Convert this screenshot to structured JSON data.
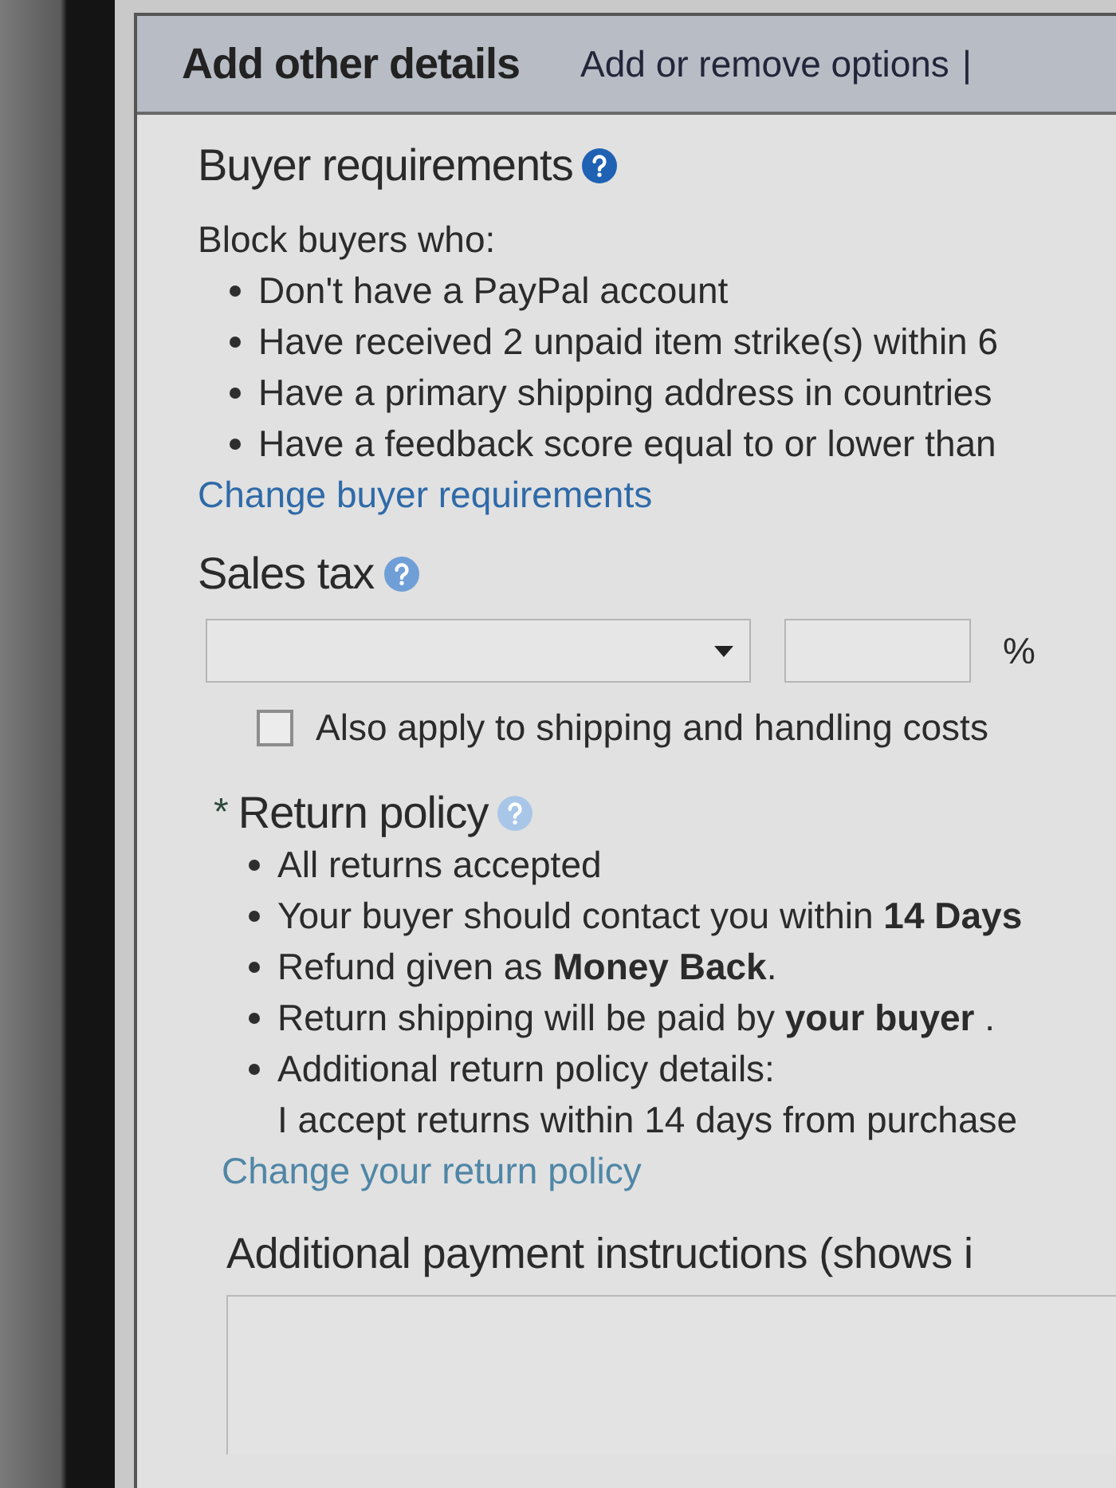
{
  "header": {
    "title": "Add other details",
    "link": "Add or remove options",
    "separator": "|"
  },
  "buyer_requirements": {
    "title": "Buyer requirements",
    "intro": "Block buyers who:",
    "items": [
      "Don't have a PayPal account",
      "Have received 2 unpaid item strike(s) within 6",
      "Have a primary shipping address in countries",
      "Have a feedback score equal to or lower than"
    ],
    "link": "Change buyer requirements"
  },
  "sales_tax": {
    "title": "Sales tax",
    "unit": "%",
    "checkbox": {
      "label": "Also apply to shipping and handling costs",
      "checked": false
    }
  },
  "return_policy": {
    "required_mark": "*",
    "title": "Return policy",
    "items": [
      "All returns accepted",
      "Your buyer should contact you within **14 Days**",
      "Refund given as **Money Back**.",
      "Return shipping will be paid by **your buyer** .",
      "Additional return policy details:"
    ],
    "details": "I accept returns within 14 days from purchase",
    "link": "Change your return policy"
  },
  "payment_instructions": {
    "title": "Additional payment instructions (shows i"
  }
}
